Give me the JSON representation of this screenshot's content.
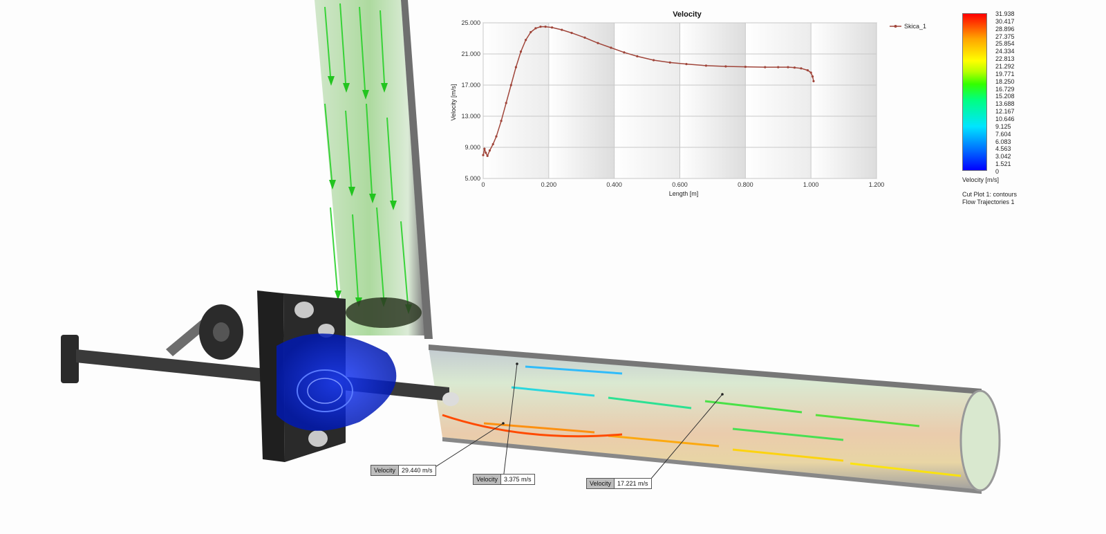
{
  "chart_data": {
    "type": "line",
    "title": "Velocity",
    "xlabel": "Length [m]",
    "ylabel": "Velocity [m/s]",
    "xlim": [
      0,
      1.2
    ],
    "ylim": [
      5.0,
      25.0
    ],
    "x_ticks": [
      "0",
      "0.200",
      "0.400",
      "0.600",
      "0.800",
      "1.000",
      "1.200"
    ],
    "y_ticks": [
      "5.000",
      "9.000",
      "13.000",
      "17.000",
      "21.000",
      "25.000"
    ],
    "legend_position": "right",
    "grid": true,
    "series": [
      {
        "name": "Skica_1",
        "color": "#a0453a",
        "x": [
          0,
          0.004,
          0.008,
          0.013,
          0.02,
          0.03,
          0.04,
          0.055,
          0.07,
          0.085,
          0.1,
          0.115,
          0.13,
          0.145,
          0.16,
          0.175,
          0.19,
          0.21,
          0.24,
          0.27,
          0.31,
          0.35,
          0.39,
          0.43,
          0.47,
          0.52,
          0.57,
          0.62,
          0.68,
          0.74,
          0.8,
          0.86,
          0.9,
          0.93,
          0.95,
          0.97,
          0.99,
          1.0,
          1.005,
          1.008
        ],
        "y": [
          8.0,
          8.8,
          8.3,
          7.9,
          8.6,
          9.4,
          10.4,
          12.4,
          14.7,
          17.0,
          19.3,
          21.3,
          22.8,
          23.8,
          24.3,
          24.5,
          24.5,
          24.4,
          24.1,
          23.7,
          23.1,
          22.4,
          21.8,
          21.2,
          20.7,
          20.2,
          19.9,
          19.7,
          19.5,
          19.4,
          19.35,
          19.3,
          19.3,
          19.3,
          19.25,
          19.15,
          18.9,
          18.6,
          18.1,
          17.5
        ]
      }
    ]
  },
  "colorbar": {
    "title": "Velocity [m/s]",
    "ticks": [
      "31.938",
      "30.417",
      "28.896",
      "27.375",
      "25.854",
      "24.334",
      "22.813",
      "21.292",
      "19.771",
      "18.250",
      "16.729",
      "15.208",
      "13.688",
      "12.167",
      "10.646",
      "9.125",
      "7.604",
      "6.083",
      "4.563",
      "3.042",
      "1.521",
      "0"
    ],
    "colors": [
      "#ff0000",
      "#ffa500",
      "#ffff00",
      "#33ff00",
      "#00e5ff",
      "#0000ff"
    ]
  },
  "plot_list": [
    "Cut Plot 1: contours",
    "Flow Trajectories 1"
  ],
  "probes": [
    {
      "key": "Velocity",
      "value": "29.440 m/s"
    },
    {
      "key": "Velocity",
      "value": "3.375 m/s"
    },
    {
      "key": "Velocity",
      "value": "17.221 m/s"
    }
  ]
}
